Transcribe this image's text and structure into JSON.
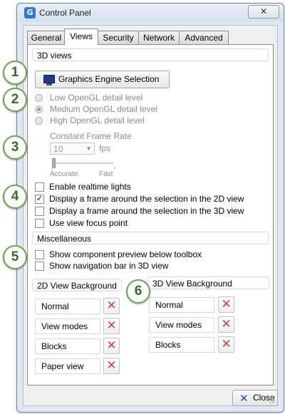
{
  "window": {
    "title": "Control Panel",
    "app_icon_glyph": "G",
    "close_glyph": "✕"
  },
  "tabs": [
    {
      "label": "General",
      "active": false
    },
    {
      "label": "Views",
      "active": true
    },
    {
      "label": "Security",
      "active": false
    },
    {
      "label": "Network",
      "active": false
    },
    {
      "label": "Advanced",
      "active": false
    }
  ],
  "views_3d": {
    "header": "3D views",
    "graphics_button": "Graphics Engine Selection",
    "opengl_levels": [
      {
        "label": "Low OpenGL detail level",
        "checked": false
      },
      {
        "label": "Medium OpenGL detail level",
        "checked": true
      },
      {
        "label": "High OpenGL detail level",
        "checked": false
      }
    ],
    "frame_rate": {
      "label": "Constant Frame Rate",
      "value": "10",
      "unit": "fps",
      "slider_min_label": "Accurate",
      "slider_max_label": "Fast",
      "slider_level": 0
    },
    "options": [
      {
        "label": "Enable realtime lights",
        "checked": false
      },
      {
        "label": "Display a frame around the selection in the 2D view",
        "checked": true
      },
      {
        "label": "Display a frame around the selection in the 3D view",
        "checked": false
      },
      {
        "label": "Use view focus point",
        "checked": false
      }
    ]
  },
  "misc": {
    "header": "Miscellaneous",
    "options": [
      {
        "label": "Show component preview below toolbox",
        "checked": false
      },
      {
        "label": "Show navigation bar in 3D view",
        "checked": false
      }
    ]
  },
  "bg_2d": {
    "header": "2D View Background",
    "items": [
      "Normal",
      "View modes",
      "Blocks",
      "Paper view"
    ]
  },
  "bg_3d": {
    "header": "3D View Background",
    "items": [
      "Normal",
      "View modes",
      "Blocks"
    ]
  },
  "footer": {
    "close_label": "Close"
  },
  "callouts": [
    "1",
    "2",
    "3",
    "4",
    "5",
    "6"
  ],
  "colors": {
    "callout_border": "#6aa84f",
    "callout_text": "#2f6f2a",
    "delete_x": "#d0423c"
  }
}
